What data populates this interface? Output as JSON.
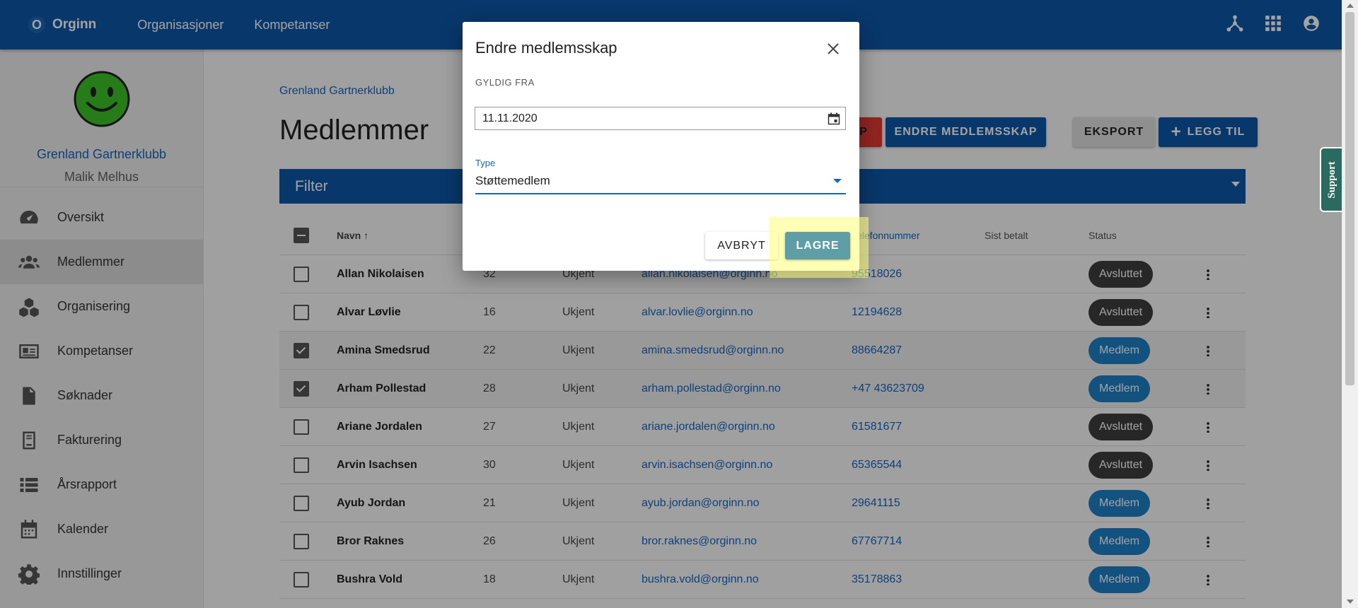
{
  "topbar": {
    "logo_letter": "O",
    "brand": "Orginn",
    "nav": [
      "Organisasjoner",
      "Kompetanser"
    ],
    "icons": [
      "hierarchy-icon",
      "apps-grid-icon",
      "account-icon"
    ]
  },
  "sidebar": {
    "org_name": "Grenland Gartnerklubb",
    "user_name": "Malik Melhus",
    "items": [
      {
        "label": "Oversikt",
        "icon": "dashboard-gauge-icon"
      },
      {
        "label": "Medlemmer",
        "icon": "people-icon"
      },
      {
        "label": "Organisering",
        "icon": "boxes-icon"
      },
      {
        "label": "Kompetanser",
        "icon": "id-card-icon"
      },
      {
        "label": "Søknader",
        "icon": "document-icon"
      },
      {
        "label": "Fakturering",
        "icon": "invoice-icon"
      },
      {
        "label": "Årsrapport",
        "icon": "list-icon"
      },
      {
        "label": "Kalender",
        "icon": "calendar-icon"
      },
      {
        "label": "Innstillinger",
        "icon": "gear-icon"
      }
    ]
  },
  "main": {
    "breadcrumb": "Grenland Gartnerklubb",
    "title": "Medlemmer",
    "buttons": {
      "red_partial": "P",
      "endre": "ENDRE MEDLEMSSKAP",
      "eksport": "EKSPORT",
      "add": "LEGG TIL"
    },
    "filter_label": "Filter",
    "columns": {
      "name": "Navn",
      "phone": "Telefonnummer",
      "paid": "Sist betalt",
      "status": "Status"
    },
    "rows": [
      {
        "name": "Allan Nikolaisen",
        "age": "32",
        "gender": "Ukjent",
        "email": "allan.nikolaisen@orginn.no",
        "phone": "95518026",
        "status": "Avsluttet",
        "checked": false
      },
      {
        "name": "Alvar Løvlie",
        "age": "16",
        "gender": "Ukjent",
        "email": "alvar.lovlie@orginn.no",
        "phone": "12194628",
        "status": "Avsluttet",
        "checked": false
      },
      {
        "name": "Amina Smedsrud",
        "age": "22",
        "gender": "Ukjent",
        "email": "amina.smedsrud@orginn.no",
        "phone": "88664287",
        "status": "Medlem",
        "checked": true
      },
      {
        "name": "Arham Pollestad",
        "age": "28",
        "gender": "Ukjent",
        "email": "arham.pollestad@orginn.no",
        "phone": "+47 43623709",
        "status": "Medlem",
        "checked": true
      },
      {
        "name": "Ariane Jordalen",
        "age": "27",
        "gender": "Ukjent",
        "email": "ariane.jordalen@orginn.no",
        "phone": "61581677",
        "status": "Avsluttet",
        "checked": false
      },
      {
        "name": "Arvin Isachsen",
        "age": "30",
        "gender": "Ukjent",
        "email": "arvin.isachsen@orginn.no",
        "phone": "65365544",
        "status": "Avsluttet",
        "checked": false
      },
      {
        "name": "Ayub Jordan",
        "age": "21",
        "gender": "Ukjent",
        "email": "ayub.jordan@orginn.no",
        "phone": "29641115",
        "status": "Medlem",
        "checked": false
      },
      {
        "name": "Bror Raknes",
        "age": "26",
        "gender": "Ukjent",
        "email": "bror.raknes@orginn.no",
        "phone": "67767714",
        "status": "Medlem",
        "checked": false
      },
      {
        "name": "Bushra Vold",
        "age": "18",
        "gender": "Ukjent",
        "email": "bushra.vold@orginn.no",
        "phone": "35178863",
        "status": "Medlem",
        "checked": false
      }
    ]
  },
  "dialog": {
    "title": "Endre medlemsskap",
    "from_label": "GYLDIG FRA",
    "date_value": "11.11.2020",
    "type_label": "Type",
    "type_value": "Støttemedlem",
    "cancel": "AVBRYT",
    "save": "LAGRE"
  },
  "support_tab": "Support",
  "colors": {
    "primary": "#0d57a8",
    "badge_avsluttet": "#3d3d3d",
    "badge_medlem": "#1e7fc6",
    "save_button": "#5f9ea6",
    "highlight": "#ffff78"
  }
}
